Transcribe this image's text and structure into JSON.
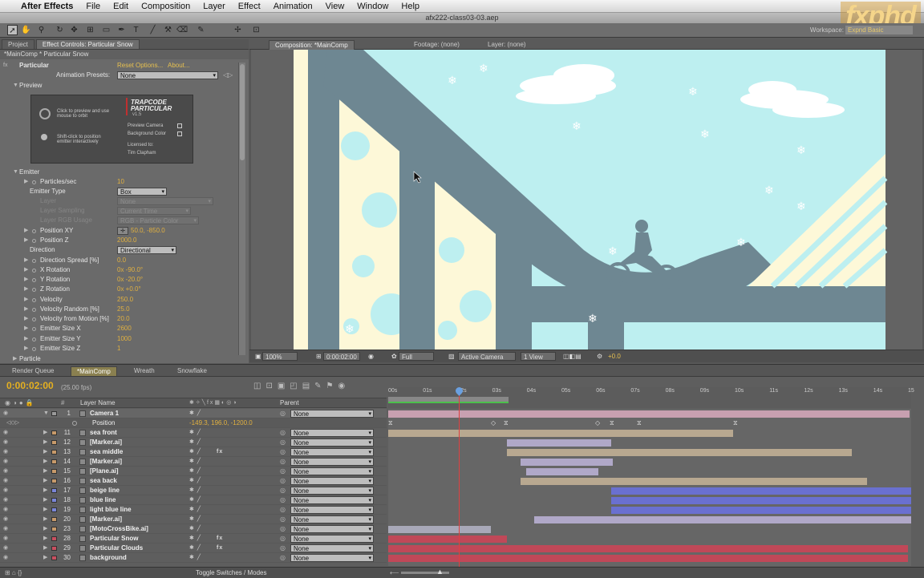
{
  "menu": {
    "app": "After Effects",
    "items": [
      "File",
      "Edit",
      "Composition",
      "Layer",
      "Effect",
      "Animation",
      "View",
      "Window",
      "Help"
    ]
  },
  "window_title": "afx222-class03-03.aep",
  "watermark": "fxphd",
  "toolbar": {
    "workspace_label": "Workspace:",
    "workspace_value": "Expnd Basic"
  },
  "left_panel": {
    "tabs": [
      "Project",
      "Effect Controls: Particular Snow"
    ],
    "subtitle": "*MainComp * Particular Snow",
    "effect_name": "Particular",
    "reset": "Reset",
    "options": "Options...",
    "about": "About...",
    "anim_presets_label": "Animation Presets:",
    "anim_presets_value": "None",
    "preview_label": "Preview",
    "preview": {
      "orbit_text": "Click to preview and use mouse to orbit",
      "shift_text": "Shift-click to position emitter interactively",
      "brand_line1": "TRAPCODE",
      "brand_line2": "PARTICULAR",
      "version": "v1.5",
      "preview_camera": "Preview Camera",
      "background_color": "Background Color",
      "licensed_to": "Licensed to:",
      "licensee": "Tim Clapham"
    },
    "emitter_label": "Emitter",
    "params": [
      {
        "label": "Particles/sec",
        "value": "10",
        "type": "value"
      },
      {
        "label": "Emitter Type",
        "value": "Box",
        "type": "dropdown"
      },
      {
        "label": "Layer",
        "value": "None",
        "type": "dim"
      },
      {
        "label": "Layer Sampling",
        "value": "Current Time",
        "type": "dim"
      },
      {
        "label": "Layer RGB Usage",
        "value": "RGB - Particle Color",
        "type": "dim"
      },
      {
        "label": "Position XY",
        "value": "50.0, -850.0",
        "type": "value"
      },
      {
        "label": "Position Z",
        "value": "2000.0",
        "type": "value"
      },
      {
        "label": "Direction",
        "value": "Directional",
        "type": "dropdown"
      },
      {
        "label": "Direction Spread [%]",
        "value": "0.0",
        "type": "value"
      },
      {
        "label": "X Rotation",
        "value": "0x -90.0°",
        "type": "value"
      },
      {
        "label": "Y Rotation",
        "value": "0x -20.0°",
        "type": "value"
      },
      {
        "label": "Z Rotation",
        "value": "0x +0.0°",
        "type": "value"
      },
      {
        "label": "Velocity",
        "value": "250.0",
        "type": "value"
      },
      {
        "label": "Velocity Random [%]",
        "value": "25.0",
        "type": "value"
      },
      {
        "label": "Velocity from Motion [%]",
        "value": "20.0",
        "type": "value"
      },
      {
        "label": "Emitter Size X",
        "value": "2600",
        "type": "value"
      },
      {
        "label": "Emitter Size Y",
        "value": "1000",
        "type": "value"
      },
      {
        "label": "Emitter Size Z",
        "value": "1",
        "type": "value"
      }
    ],
    "particle_label": "Particle"
  },
  "comp_panel": {
    "tabs": [
      "Composition: *MainComp",
      "Footage: (none)",
      "Layer: (none)"
    ],
    "status": {
      "zoom": "100%",
      "timecode": "0:00:02:00",
      "resolution": "Full",
      "camera": "Active Camera",
      "views": "1 View",
      "exposure": "+0.0"
    }
  },
  "timeline": {
    "tabs": [
      "Render Queue",
      "*MainComp",
      "Wreath",
      "Snowflake"
    ],
    "timecode": "0:00:02:00",
    "fps": "(25.00 fps)",
    "col_layer_name": "Layer Name",
    "col_parent": "Parent",
    "ruler": [
      "00s",
      "01s",
      "02s",
      "03s",
      "04s",
      "05s",
      "06s",
      "07s",
      "08s",
      "09s",
      "10s",
      "11s",
      "12s",
      "13s",
      "14s",
      "15"
    ],
    "position_label": "Position",
    "position_value": "-149.3, 196.0, -1200.0",
    "layers": [
      {
        "num": "1",
        "name": "Camera 1",
        "color": "#9a9a9a",
        "parent": "None",
        "fx": ""
      },
      {
        "num": "11",
        "name": "sea front",
        "color": "#c79a6a",
        "parent": "None",
        "fx": ""
      },
      {
        "num": "12",
        "name": "[Marker.ai]",
        "color": "#c79a6a",
        "parent": "None",
        "fx": ""
      },
      {
        "num": "13",
        "name": "sea middle",
        "color": "#c79a6a",
        "parent": "None",
        "fx": "fx"
      },
      {
        "num": "14",
        "name": "[Marker.ai]",
        "color": "#c79a6a",
        "parent": "None",
        "fx": ""
      },
      {
        "num": "15",
        "name": "[Plane.ai]",
        "color": "#c79a6a",
        "parent": "None",
        "fx": ""
      },
      {
        "num": "16",
        "name": "sea back",
        "color": "#c79a6a",
        "parent": "None",
        "fx": ""
      },
      {
        "num": "17",
        "name": "beige line",
        "color": "#7a86d8",
        "parent": "None",
        "fx": ""
      },
      {
        "num": "18",
        "name": "blue line",
        "color": "#7a86d8",
        "parent": "None",
        "fx": ""
      },
      {
        "num": "19",
        "name": "light blue line",
        "color": "#7a86d8",
        "parent": "None",
        "fx": ""
      },
      {
        "num": "20",
        "name": "[Marker.ai]",
        "color": "#c79a6a",
        "parent": "None",
        "fx": ""
      },
      {
        "num": "23",
        "name": "[MotoCrossBike.ai]",
        "color": "#c79a6a",
        "parent": "None",
        "fx": ""
      },
      {
        "num": "28",
        "name": "Particular Snow",
        "color": "#c85060",
        "parent": "None",
        "fx": "fx"
      },
      {
        "num": "29",
        "name": "Particular Clouds",
        "color": "#c85060",
        "parent": "None",
        "fx": "fx"
      },
      {
        "num": "30",
        "name": "background",
        "color": "#c85060",
        "parent": "None",
        "fx": ""
      }
    ],
    "toggle_label": "Toggle Switches / Modes"
  }
}
